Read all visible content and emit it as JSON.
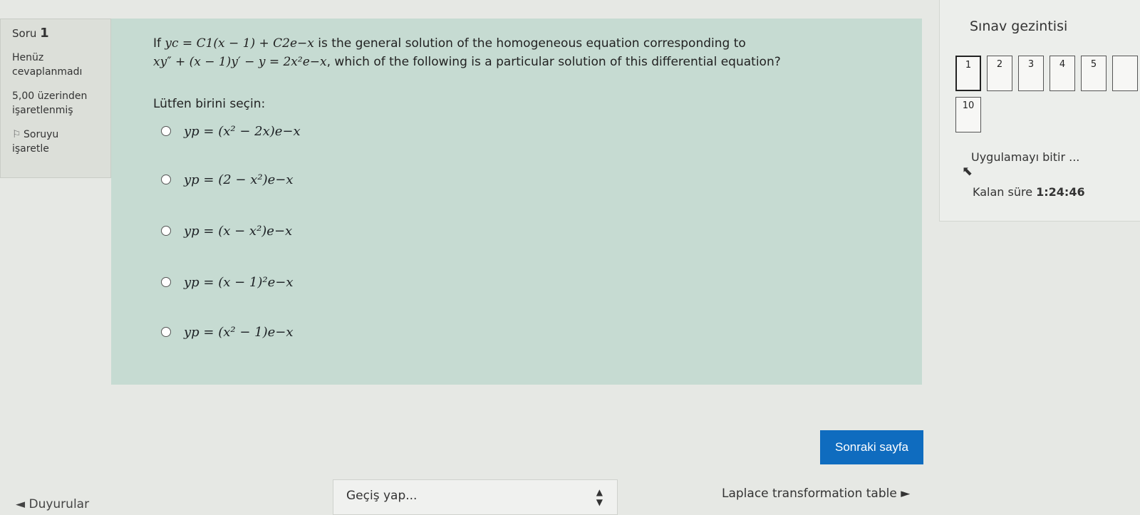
{
  "question_info": {
    "number_label": "Soru",
    "number": "1",
    "status_line1": "Henüz",
    "status_line2": "cevaplanmadı",
    "points_line1": "5,00 üzerinden",
    "points_line2": "işaretlenmiş",
    "flag_line1": "Soruyu",
    "flag_line2": "işaretle"
  },
  "question": {
    "line1_pre": "If ",
    "line1_math": "yc = C1(x − 1) + C2e−x",
    "line1_post": " is the general solution of the homogeneous equation corresponding to",
    "line2_math": "xy″ + (x − 1)y′ − y = 2x²e−x",
    "line2_post": ", which of the following is a particular solution of this differential equation?",
    "prompt": "Lütfen birini seçin:",
    "options": [
      "yp = (x² − 2x)e−x",
      "yp = (2 − x²)e−x",
      "yp = (x − x²)e−x",
      "yp = (x − 1)²e−x",
      "yp = (x² − 1)e−x"
    ]
  },
  "navigation": {
    "next_button": "Sonraki sayfa",
    "jump_label": "Geçiş yap...",
    "prev_link": "◄ Duyurular",
    "next_link": "Laplace transformation table ►"
  },
  "quiz_nav": {
    "title": "Sınav gezintisi",
    "buttons": [
      "1",
      "2",
      "3",
      "4",
      "5",
      "10"
    ],
    "finish": "Uygulamayı bitir ...",
    "time_label": "Kalan süre ",
    "time_value": "1:24:46"
  },
  "colors": {
    "primary_button": "#0f6cbf",
    "question_bg": "#c6dbd2"
  }
}
